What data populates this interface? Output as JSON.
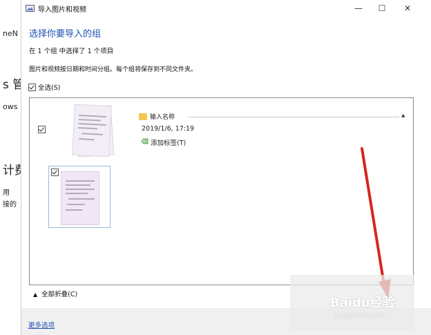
{
  "background": {
    "fragments": [
      "neN",
      "s 管",
      "ows",
      "计费",
      "用",
      "接的"
    ]
  },
  "titlebar": {
    "title": "导入图片和视频",
    "minimize": "—",
    "maximize": "☐",
    "close": "✕"
  },
  "dialog": {
    "heading": "选择你要导入的组",
    "selection_info": "在 1 个组 中选择了 1 个项目",
    "grouping_info": "图片和视频按日期和时间分组。每个组将保存到不同文件夹。",
    "select_all_label": "全选(S)",
    "select_all_checked": true
  },
  "group": {
    "checked": true,
    "name_placeholder": "输入名称",
    "date": "2019/1/6, 17:19",
    "add_tag": "添加标签(T)",
    "caret": "▲",
    "items": [
      {
        "checked": true,
        "selected": true
      }
    ]
  },
  "collapse_all": "全部折叠(C)",
  "collapse_caret": "▲",
  "footer": {
    "more_options": "更多选项"
  },
  "watermark": {
    "text": "Baidu经验",
    "sub": "jingyan.baidu.com"
  },
  "colors": {
    "heading": "#1e4fb3",
    "link": "#1e4fb3",
    "arrow": "#d7261e",
    "footer_bg": "#f0f0f0"
  }
}
